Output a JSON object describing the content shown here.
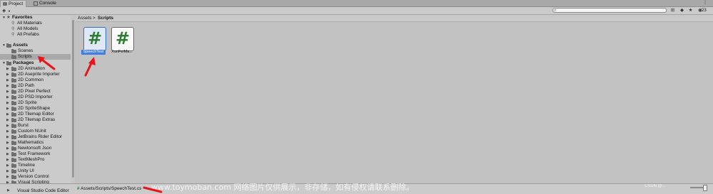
{
  "tabs": [
    {
      "label": "Project",
      "active": true
    },
    {
      "label": "Console",
      "active": false
    }
  ],
  "toolbar": {
    "add_label": "+",
    "search_placeholder": "",
    "badge_count": "23"
  },
  "tree": {
    "favorites": {
      "label": "Favorites",
      "items": [
        "All Materials",
        "All Models",
        "All Prefabs"
      ]
    },
    "assets": {
      "label": "Assets",
      "items": [
        "Scenes",
        "Scripts"
      ],
      "selected": "Scripts"
    },
    "packages": {
      "label": "Packages",
      "items": [
        "2D Animation",
        "2D Aseprite Importer",
        "2D Common",
        "2D Path",
        "2D Pixel Perfect",
        "2D PSD Importer",
        "2D Sprite",
        "2D SpriteShape",
        "2D Tilemap Editor",
        "2D Tilemap Extras",
        "Burst",
        "Custom NUnit",
        "JetBrains Rider Editor",
        "Mathematics",
        "Newtonsoft Json",
        "Test Framework",
        "TextMeshPro",
        "Timeline",
        "Unity UI",
        "Version Control",
        "Visual Scripting",
        "Visual Studio Code Editor"
      ]
    }
  },
  "breadcrumb": {
    "parts": [
      "Assets",
      "Scripts"
    ],
    "separator": ">"
  },
  "files": [
    {
      "name": "SpeechTest",
      "selected": true,
      "icon": "csharp-script-icon"
    },
    {
      "name": "XunFeiMa...",
      "selected": false,
      "icon": "csharp-script-icon"
    }
  ],
  "status": {
    "path": "Assets/Scripts/SpeechTest.cs"
  },
  "watermark": {
    "text": "www.toymoban.com 网络图片仅供展示，非存储，如有侵权请联系删除。",
    "credit": "CSDN @..."
  },
  "colors": {
    "annotation_arrow": "#e8141b",
    "selection": "#3f7de0",
    "script_hash": "#2e7d32"
  }
}
